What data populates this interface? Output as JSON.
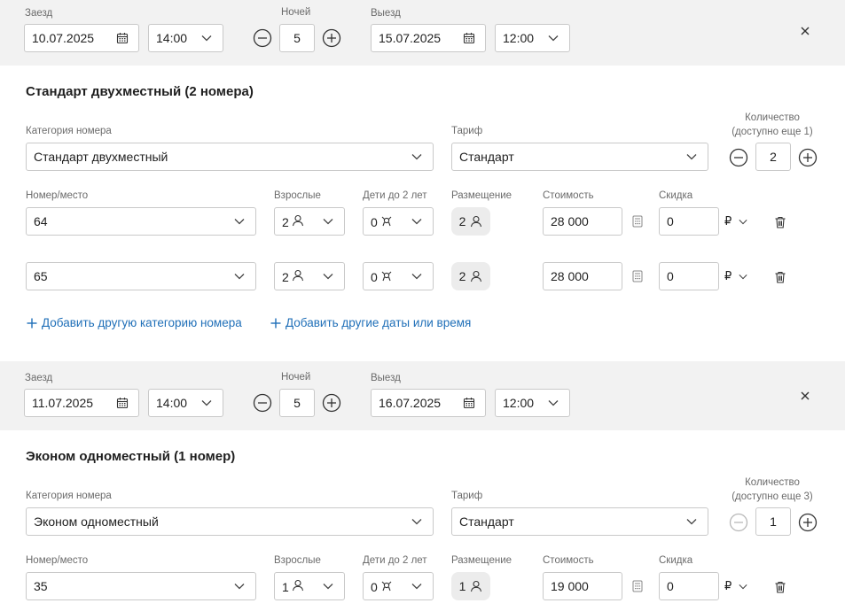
{
  "labels": {
    "checkin": "Заезд",
    "nights": "Ночей",
    "checkout": "Выезд",
    "room_category": "Категория номера",
    "tariff": "Тариф",
    "room_place": "Номер/место",
    "adults": "Взрослые",
    "children": "Дети до 2 лет",
    "accommodation": "Размещение",
    "cost": "Стоимость",
    "discount": "Скидка",
    "currency": "₽"
  },
  "bookings": [
    {
      "checkin_date": "10.07.2025",
      "checkin_time": "14:00",
      "nights": "5",
      "checkout_date": "15.07.2025",
      "checkout_time": "12:00",
      "title": "Стандарт двухместный (2 номера)",
      "category": "Стандарт двухместный",
      "tariff": "Стандарт",
      "quantity_label_1": "Количество",
      "quantity_label_2": "(доступно еще 1)",
      "quantity": "2",
      "rooms": [
        {
          "number": "64",
          "adults": "2",
          "children": "0",
          "placement": "2",
          "cost": "28 000",
          "discount": "0"
        },
        {
          "number": "65",
          "adults": "2",
          "children": "0",
          "placement": "2",
          "cost": "28 000",
          "discount": "0"
        }
      ],
      "add_category_link": "Добавить другую категорию номера",
      "add_dates_link": "Добавить другие даты или время"
    },
    {
      "checkin_date": "11.07.2025",
      "checkin_time": "14:00",
      "nights": "5",
      "checkout_date": "16.07.2025",
      "checkout_time": "12:00",
      "title": "Эконом одноместный (1 номер)",
      "category": "Эконом одноместный",
      "tariff": "Стандарт",
      "quantity_label_1": "Количество",
      "quantity_label_2": "(доступно еще 3)",
      "quantity": "1",
      "rooms": [
        {
          "number": "35",
          "adults": "1",
          "children": "0",
          "placement": "1",
          "cost": "19 000",
          "discount": "0"
        }
      ]
    }
  ],
  "colors": {
    "link": "#1f6fb8",
    "bar_bg": "#f2f2f2",
    "border": "#c9c9c9"
  }
}
